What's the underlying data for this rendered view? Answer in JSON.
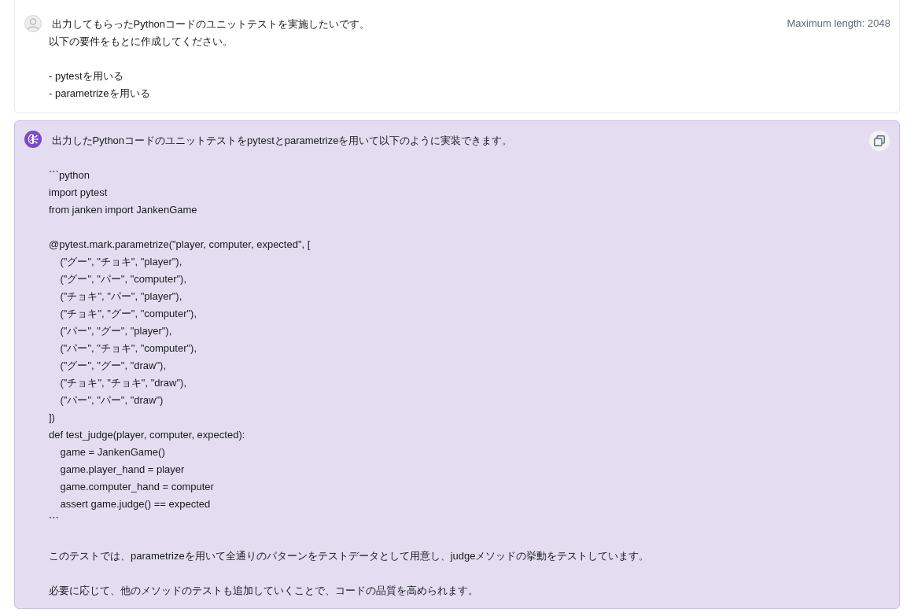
{
  "user_message": {
    "blocks": [
      [
        " 出力してもらったPythonコードのユニットテストを実施したいです。",
        "以下の要件をもとに作成してください。"
      ],
      [
        "- pytestを用いる",
        "- parametrizeを用いる"
      ]
    ],
    "max_length": "Maximum length: 2048"
  },
  "assistant_message": {
    "blocks": [
      [
        " 出力したPythonコードのユニットテストをpytestとparametrizeを用いて以下のように実装できます。"
      ],
      [
        "```python",
        "import pytest",
        "from janken import JankenGame"
      ],
      [
        "@pytest.mark.parametrize(\"player, computer, expected\", [",
        "    (\"グー\", \"チョキ\", \"player\"),",
        "    (\"グー\", \"パー\", \"computer\"),",
        "    (\"チョキ\", \"パー\", \"player\"),",
        "    (\"チョキ\", \"グー\", \"computer\"),",
        "    (\"パー\", \"グー\", \"player\"),",
        "    (\"パー\", \"チョキ\", \"computer\"),",
        "    (\"グー\", \"グー\", \"draw\"),",
        "    (\"チョキ\", \"チョキ\", \"draw\"),",
        "    (\"パー\", \"パー\", \"draw\")",
        "])",
        "def test_judge(player, computer, expected):",
        "    game = JankenGame()",
        "    game.player_hand = player",
        "    game.computer_hand = computer",
        "    assert game.judge() == expected",
        "```"
      ],
      [
        "このテストでは、parametrizeを用いて全通りのパターンをテストデータとして用意し、judgeメソッドの挙動をテストしています。"
      ],
      [
        "必要に応じて、他のメソッドのテストも追加していくことで、コードの品質を高められます。"
      ]
    ]
  }
}
